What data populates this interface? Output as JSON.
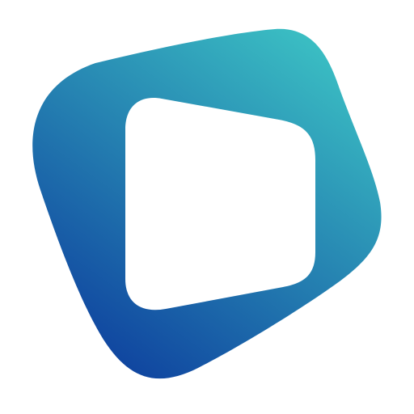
{
  "logo": {
    "icon": "rounded-quadrilateral-ring-logo",
    "gradient_start_color": "#1046A0",
    "gradient_end_color": "#3CC2C4",
    "background_color": "#FFFFFF",
    "inner_color": "#FFFFFF"
  }
}
